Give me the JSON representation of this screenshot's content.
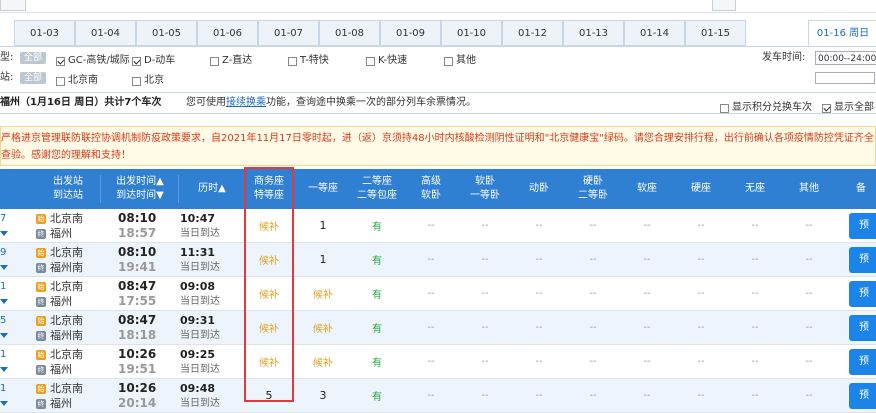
{
  "date_tabs": [
    "01-03",
    "01-04",
    "01-05",
    "01-06",
    "01-07",
    "01-08",
    "01-09",
    "01-10",
    "01-12",
    "01-13",
    "01-14",
    "01-15",
    "01-16 周日"
  ],
  "filters": {
    "type_label": "型:",
    "all_label": "全部",
    "types": [
      {
        "label": "GC-高铁/城际",
        "checked": true
      },
      {
        "label": "D-动车",
        "checked": true
      },
      {
        "label": "Z-直达",
        "checked": false
      },
      {
        "label": "T-特快",
        "checked": false
      },
      {
        "label": "K-快速",
        "checked": false
      },
      {
        "label": "其他",
        "checked": false
      }
    ],
    "station_label": "站:",
    "stations": [
      {
        "label": "北京南",
        "checked": false
      },
      {
        "label": "北京",
        "checked": false
      }
    ],
    "depart_time_label": "发车时间:",
    "depart_time_value": "00:00--24:00"
  },
  "info": {
    "route": "福州（1月16日  周日）共计7个车次",
    "tip_prefix": "您可使用",
    "tip_link": "接续换乘",
    "tip_suffix": "功能，查询途中换乘一次的部分列车余票情况。",
    "opt1": "显示积分兑换车次",
    "opt2": "显示全部"
  },
  "notice": {
    "line1": "严格进京管理联防联控协调机制防疫政策要求，自2021年11月17日零时起，进（返）京须持48小时内核酸检测阴性证明和\"北京健康宝\"绿码。请您合理安排行程，出行前确认各项疫情防控凭证齐全，在进站",
    "line2": "查验。感谢您的理解和支持！"
  },
  "header": {
    "station1": "出发站",
    "station2": "到达站",
    "time1": "出发时间▲",
    "time2": "到达时间▼",
    "duration": "历时▲",
    "business1": "商务座",
    "business2": "特等座",
    "first": "一等座",
    "second1": "二等座",
    "second2": "二等包座",
    "softsleep1": "高级",
    "softsleep2": "软卧",
    "softbed1": "软卧",
    "softbed2": "一等卧",
    "moving": "动卧",
    "hardsleep1": "硬卧",
    "hardsleep2": "二等卧",
    "softseat": "软座",
    "hardseat": "硬座",
    "noseat": "无座",
    "other": "其他",
    "remark": "备"
  },
  "rows": [
    {
      "no": "7",
      "from": "北京南",
      "to": "福州",
      "dep": "08:10",
      "arr": "18:57",
      "dur": "10:47",
      "day": "当日到达",
      "business": "候补",
      "first": "1",
      "second": "有",
      "book": "预"
    },
    {
      "no": "9",
      "from": "北京南",
      "to": "福州南",
      "dep": "08:10",
      "arr": "19:41",
      "dur": "11:31",
      "day": "当日到达",
      "business": "候补",
      "first": "1",
      "second": "有",
      "book": "预"
    },
    {
      "no": "1",
      "from": "北京南",
      "to": "福州",
      "dep": "08:47",
      "arr": "17:55",
      "dur": "09:08",
      "day": "当日到达",
      "business": "候补",
      "first": "候补",
      "second": "有",
      "book": "预"
    },
    {
      "no": "5",
      "from": "北京南",
      "to": "福州南",
      "dep": "08:47",
      "arr": "18:18",
      "dur": "09:31",
      "day": "当日到达",
      "business": "候补",
      "first": "候补",
      "second": "有",
      "book": "预"
    },
    {
      "no": "1",
      "from": "北京南",
      "to": "福州",
      "dep": "10:26",
      "arr": "19:51",
      "dur": "09:25",
      "day": "当日到达",
      "business": "候补",
      "first": "候补",
      "second": "有",
      "book": "预"
    },
    {
      "no": "1",
      "from": "北京南",
      "to": "福州",
      "dep": "10:26",
      "arr": "20:14",
      "dur": "09:48",
      "day": "当日到达",
      "business": "5",
      "first": "3",
      "second": "有",
      "book": "预"
    }
  ],
  "dash": "--",
  "colors": {
    "header_blue": "#2f7fd2",
    "candidate_orange": "#e8a020",
    "available_green": "#28a745",
    "highlight_red": "#e23a3a"
  }
}
